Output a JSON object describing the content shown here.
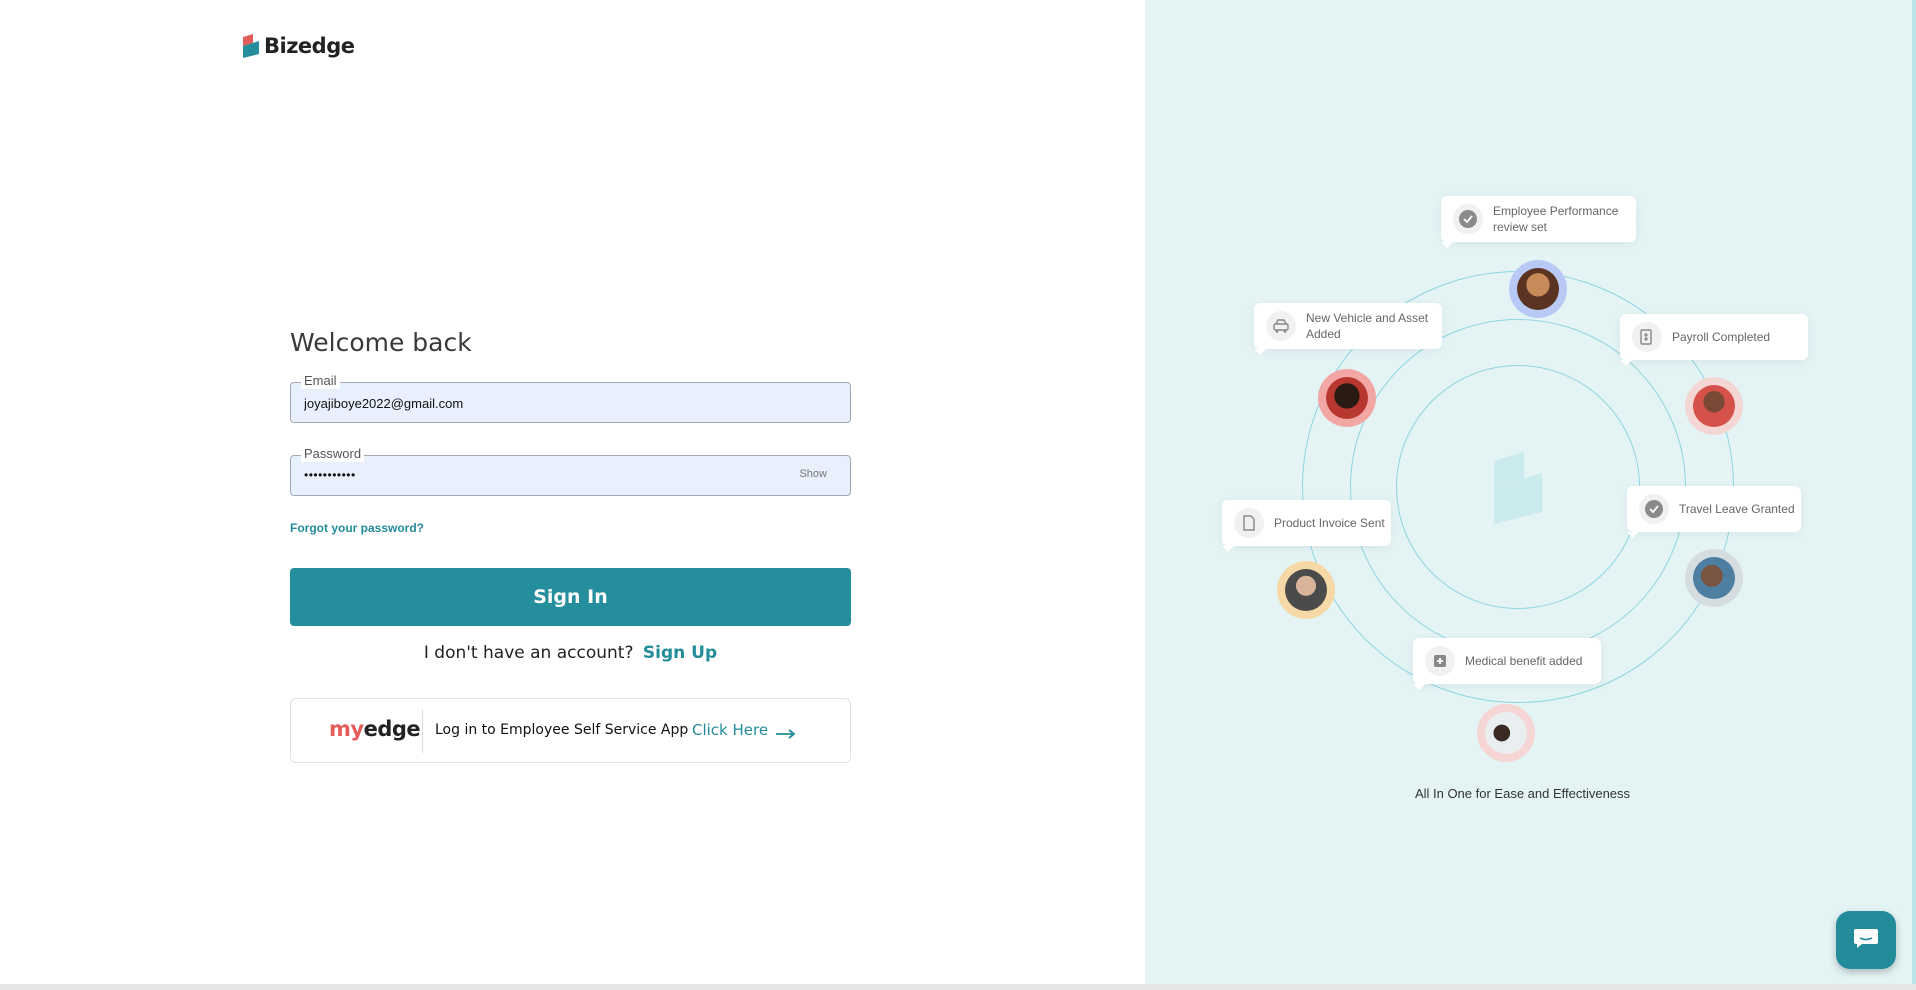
{
  "brand": {
    "name": "Bizedge"
  },
  "login": {
    "heading": "Welcome back",
    "email_label": "Email",
    "email_value": "joyajiboye2022@gmail.com",
    "password_label": "Password",
    "password_value": "•••••••••••",
    "show_label": "Show",
    "forgot_label": "Forgot your password?",
    "signin_label": "Sign In",
    "no_account_text": "I don't have an account?",
    "signup_label": "Sign Up"
  },
  "ess": {
    "logo_my": "my",
    "logo_edge": "edge",
    "text": "Log in to Employee Self Service App",
    "link_label": "Click Here"
  },
  "illustration": {
    "cards": {
      "performance": "Employee Performance review set",
      "vehicle": "New Vehicle and Asset Added",
      "payroll": "Payroll Completed",
      "invoice": "Product Invoice Sent",
      "travel": "Travel Leave Granted",
      "medical": "Medical benefit added"
    },
    "tagline": "All In One for Ease and Effectiveness"
  },
  "colors": {
    "accent": "#248e9c",
    "panel_bg": "#e4f4f5",
    "input_bg": "#e8f0fe",
    "brand_red": "#e35d5b"
  }
}
